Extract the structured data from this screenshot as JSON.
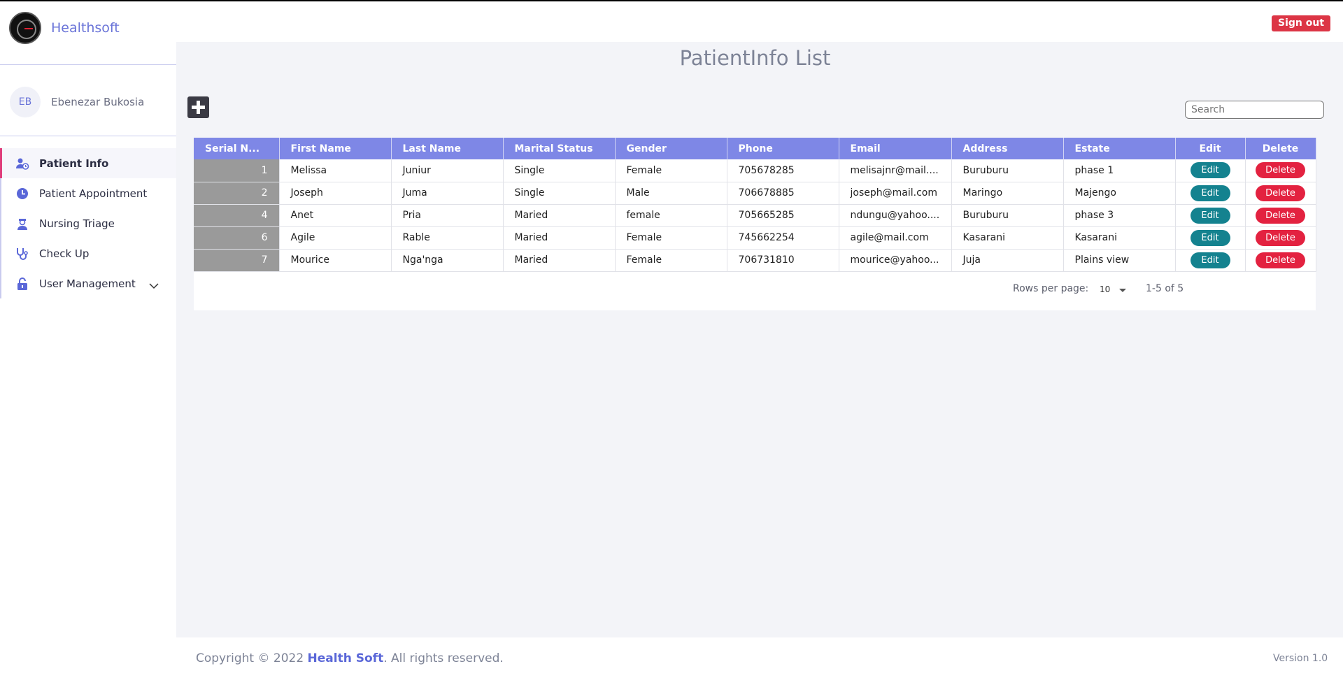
{
  "header": {
    "brand": "Healthsoft",
    "signout_label": "Sign out"
  },
  "user": {
    "initials": "EB",
    "name": "Ebenezar Bukosia"
  },
  "nav": [
    {
      "label": "Patient Info",
      "icon": "user-clock-icon",
      "active": true
    },
    {
      "label": "Patient Appointment",
      "icon": "clock-icon"
    },
    {
      "label": "Nursing Triage",
      "icon": "nurse-icon"
    },
    {
      "label": "Check Up",
      "icon": "stethoscope-icon"
    },
    {
      "label": "User Management",
      "icon": "lock-open-icon",
      "expandable": true
    }
  ],
  "main": {
    "title": "PatientInfo List",
    "search_placeholder": "Search",
    "columns": [
      "Serial N...",
      "First Name",
      "Last Name",
      "Marital Status",
      "Gender",
      "Phone",
      "Email",
      "Address",
      "Estate",
      "Edit",
      "Delete"
    ],
    "rows": [
      {
        "serial": "1",
        "first": "Melissa",
        "last": "Juniur",
        "marital": "Single",
        "gender": "Female",
        "phone": "705678285",
        "email": "melisajnr@mail....",
        "address": "Buruburu",
        "estate": "phase 1"
      },
      {
        "serial": "2",
        "first": "Joseph",
        "last": "Juma",
        "marital": "Single",
        "gender": "Male",
        "phone": "706678885",
        "email": "joseph@mail.com",
        "address": "Maringo",
        "estate": "Majengo"
      },
      {
        "serial": "4",
        "first": "Anet",
        "last": "Pria",
        "marital": "Maried",
        "gender": "female",
        "phone": "705665285",
        "email": "ndungu@yahoo....",
        "address": "Buruburu",
        "estate": "phase 3"
      },
      {
        "serial": "6",
        "first": "Agile",
        "last": "Rable",
        "marital": "Maried",
        "gender": "Female",
        "phone": "745662254",
        "email": "agile@mail.com",
        "address": "Kasarani",
        "estate": "Kasarani"
      },
      {
        "serial": "7",
        "first": "Mourice",
        "last": "Nga'nga",
        "marital": "Maried",
        "gender": "Female",
        "phone": "706731810",
        "email": "mourice@yahoo...",
        "address": "Juja",
        "estate": "Plains view"
      }
    ],
    "edit_label": "Edit",
    "delete_label": "Delete",
    "pagination": {
      "rows_label": "Rows per page:",
      "rows_value": "10",
      "range": "1-5 of 5"
    }
  },
  "footer": {
    "copyright_prefix": "Copyright © 2022 ",
    "copyright_brand": "Health Soft",
    "copyright_suffix": ". All rights reserved.",
    "version": "Version 1.0"
  },
  "colors": {
    "accent": "#7e87e6",
    "brand": "#6a74d8",
    "danger": "#e32240",
    "edit": "#14828f",
    "signout": "#dc3545"
  }
}
